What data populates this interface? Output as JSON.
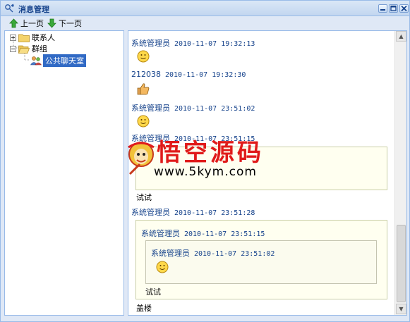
{
  "window": {
    "title": "消息管理",
    "minimize_label": "_",
    "maximize_label": "□",
    "close_label": "✕"
  },
  "toolbar": {
    "prev_label": "上一页",
    "next_label": "下一页"
  },
  "tree": {
    "contacts_label": "联系人",
    "groups_label": "群组",
    "public_room_label": "公共聊天室"
  },
  "messages": [
    {
      "sender": "系统管理员",
      "time": "2010-11-07 19:32:13",
      "content": "smile-emoji"
    },
    {
      "sender": "212038",
      "time": "2010-11-07 19:32:30",
      "content": "thumbs-up-emoji"
    },
    {
      "sender": "系统管理员",
      "time": "2010-11-07 23:51:02",
      "content": "smile-emoji"
    },
    {
      "sender": "系统管理员",
      "time": "2010-11-07 23:51:15",
      "text": "试试"
    },
    {
      "sender": "系统管理员",
      "time": "2010-11-07 23:51:28",
      "quote": {
        "sender": "系统管理员",
        "time": "2010-11-07 23:51:15",
        "quote": {
          "sender": "系统管理员",
          "time": "2010-11-07 23:51:02",
          "content": "smile-emoji"
        },
        "text": "试试"
      },
      "text": "盖楼"
    }
  ],
  "watermark": {
    "title": "悟空源码",
    "url": "www.5kym.com"
  },
  "colors": {
    "title_text": "#15428b",
    "border": "#99bbe8",
    "panel_bg": "#dfe8f6",
    "selected_bg": "#316ac5",
    "quote_bg": "#fffff0",
    "watermark_red": "#e01b1b"
  }
}
